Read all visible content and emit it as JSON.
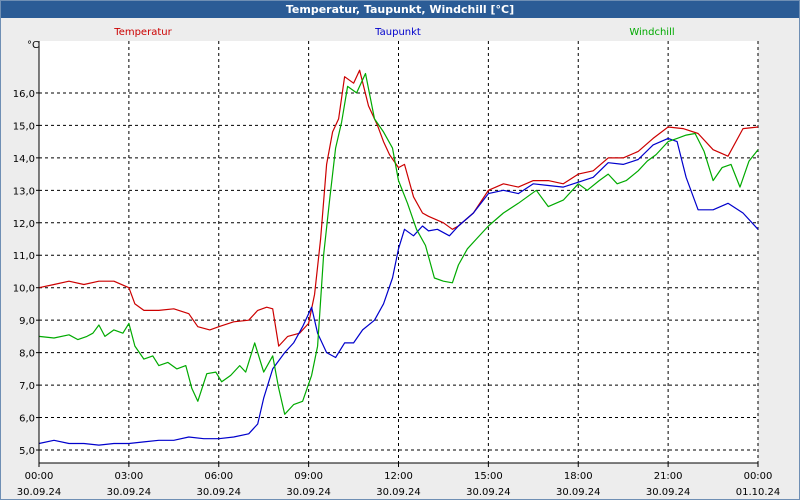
{
  "window": {
    "title": "Temperatur, Taupunkt, Windchill [°C]"
  },
  "chart_data": {
    "type": "line",
    "title": "Temperatur, Taupunkt, Windchill [°C]",
    "ylabel": "°C",
    "xlabel": "",
    "ylim": [
      4.6,
      17.6
    ],
    "xlim": [
      0,
      24
    ],
    "grid": true,
    "legend": "top",
    "y_ticks": [
      5.0,
      6.0,
      7.0,
      8.0,
      9.0,
      10.0,
      11.0,
      12.0,
      13.0,
      14.0,
      15.0,
      16.0
    ],
    "y_tick_labels": [
      "5,0",
      "6,0",
      "7,0",
      "8,0",
      "9,0",
      "10,0",
      "11,0",
      "12,0",
      "13,0",
      "14,0",
      "15,0",
      "16,0"
    ],
    "x_ticks": [
      {
        "t": 0,
        "time": "00:00",
        "date": "30.09.24"
      },
      {
        "t": 3,
        "time": "03:00",
        "date": "30.09.24"
      },
      {
        "t": 6,
        "time": "06:00",
        "date": "30.09.24"
      },
      {
        "t": 9,
        "time": "09:00",
        "date": "30.09.24"
      },
      {
        "t": 12,
        "time": "12:00",
        "date": "30.09.24"
      },
      {
        "t": 15,
        "time": "15:00",
        "date": "30.09.24"
      },
      {
        "t": 18,
        "time": "18:00",
        "date": "30.09.24"
      },
      {
        "t": 21,
        "time": "21:00",
        "date": "30.09.24"
      },
      {
        "t": 24,
        "time": "00:00",
        "date": "01.10.24"
      }
    ],
    "x_unit": "hours since 30.09.24 00:00",
    "series": [
      {
        "name": "Temperatur",
        "color": "#cc0000",
        "points": [
          [
            0,
            10.0
          ],
          [
            0.5,
            10.1
          ],
          [
            1,
            10.2
          ],
          [
            1.5,
            10.1
          ],
          [
            2,
            10.2
          ],
          [
            2.5,
            10.2
          ],
          [
            3,
            10.0
          ],
          [
            3.2,
            9.5
          ],
          [
            3.5,
            9.3
          ],
          [
            4,
            9.3
          ],
          [
            4.5,
            9.35
          ],
          [
            5,
            9.2
          ],
          [
            5.3,
            8.8
          ],
          [
            5.7,
            8.7
          ],
          [
            6,
            8.8
          ],
          [
            6.5,
            8.95
          ],
          [
            7,
            9.0
          ],
          [
            7.3,
            9.3
          ],
          [
            7.6,
            9.4
          ],
          [
            7.8,
            9.35
          ],
          [
            8,
            8.2
          ],
          [
            8.3,
            8.5
          ],
          [
            8.7,
            8.6
          ],
          [
            9,
            8.9
          ],
          [
            9.2,
            9.8
          ],
          [
            9.4,
            11.5
          ],
          [
            9.6,
            13.8
          ],
          [
            9.8,
            14.8
          ],
          [
            10,
            15.2
          ],
          [
            10.2,
            16.5
          ],
          [
            10.5,
            16.3
          ],
          [
            10.7,
            16.7
          ],
          [
            11,
            15.6
          ],
          [
            11.3,
            15.0
          ],
          [
            11.5,
            14.5
          ],
          [
            11.7,
            14.1
          ],
          [
            12,
            13.7
          ],
          [
            12.2,
            13.8
          ],
          [
            12.5,
            12.8
          ],
          [
            12.8,
            12.3
          ],
          [
            13,
            12.2
          ],
          [
            13.5,
            12.0
          ],
          [
            13.8,
            11.8
          ],
          [
            14,
            11.9
          ],
          [
            14.5,
            12.3
          ],
          [
            15,
            13.0
          ],
          [
            15.5,
            13.2
          ],
          [
            16,
            13.1
          ],
          [
            16.5,
            13.3
          ],
          [
            17,
            13.3
          ],
          [
            17.5,
            13.2
          ],
          [
            18,
            13.5
          ],
          [
            18.5,
            13.6
          ],
          [
            19,
            14.0
          ],
          [
            19.5,
            14.0
          ],
          [
            20,
            14.2
          ],
          [
            20.5,
            14.6
          ],
          [
            21,
            14.95
          ],
          [
            21.5,
            14.9
          ],
          [
            22,
            14.75
          ],
          [
            22.5,
            14.25
          ],
          [
            23,
            14.05
          ],
          [
            23.5,
            14.9
          ],
          [
            24,
            14.95
          ]
        ]
      },
      {
        "name": "Taupunkt",
        "color": "#0000cc",
        "points": [
          [
            0,
            5.2
          ],
          [
            0.5,
            5.3
          ],
          [
            1,
            5.2
          ],
          [
            1.5,
            5.2
          ],
          [
            2,
            5.15
          ],
          [
            2.5,
            5.2
          ],
          [
            3,
            5.2
          ],
          [
            3.5,
            5.25
          ],
          [
            4,
            5.3
          ],
          [
            4.5,
            5.3
          ],
          [
            5,
            5.4
          ],
          [
            5.5,
            5.35
          ],
          [
            6,
            5.35
          ],
          [
            6.5,
            5.4
          ],
          [
            7,
            5.5
          ],
          [
            7.3,
            5.8
          ],
          [
            7.5,
            6.6
          ],
          [
            7.8,
            7.5
          ],
          [
            8.2,
            8.0
          ],
          [
            8.5,
            8.3
          ],
          [
            8.8,
            8.8
          ],
          [
            9.1,
            9.4
          ],
          [
            9.3,
            8.6
          ],
          [
            9.6,
            8.0
          ],
          [
            9.9,
            7.85
          ],
          [
            10.2,
            8.3
          ],
          [
            10.5,
            8.3
          ],
          [
            10.8,
            8.7
          ],
          [
            11.2,
            9.0
          ],
          [
            11.5,
            9.5
          ],
          [
            11.8,
            10.3
          ],
          [
            12,
            11.2
          ],
          [
            12.2,
            11.8
          ],
          [
            12.5,
            11.6
          ],
          [
            12.8,
            11.9
          ],
          [
            13,
            11.75
          ],
          [
            13.3,
            11.8
          ],
          [
            13.7,
            11.6
          ],
          [
            14,
            11.9
          ],
          [
            14.5,
            12.3
          ],
          [
            15,
            12.9
          ],
          [
            15.5,
            13.0
          ],
          [
            16,
            12.9
          ],
          [
            16.5,
            13.2
          ],
          [
            17,
            13.15
          ],
          [
            17.5,
            13.1
          ],
          [
            18,
            13.25
          ],
          [
            18.5,
            13.4
          ],
          [
            19,
            13.85
          ],
          [
            19.5,
            13.8
          ],
          [
            20,
            13.95
          ],
          [
            20.5,
            14.4
          ],
          [
            21,
            14.6
          ],
          [
            21.3,
            14.5
          ],
          [
            21.6,
            13.4
          ],
          [
            22,
            12.4
          ],
          [
            22.5,
            12.4
          ],
          [
            23,
            12.6
          ],
          [
            23.5,
            12.3
          ],
          [
            24,
            11.8
          ]
        ]
      },
      {
        "name": "Windchill",
        "color": "#00aa00",
        "points": [
          [
            0,
            8.5
          ],
          [
            0.5,
            8.45
          ],
          [
            1,
            8.55
          ],
          [
            1.3,
            8.4
          ],
          [
            1.6,
            8.5
          ],
          [
            1.8,
            8.6
          ],
          [
            2,
            8.85
          ],
          [
            2.2,
            8.5
          ],
          [
            2.5,
            8.7
          ],
          [
            2.8,
            8.6
          ],
          [
            3,
            8.9
          ],
          [
            3.2,
            8.2
          ],
          [
            3.5,
            7.8
          ],
          [
            3.8,
            7.9
          ],
          [
            4,
            7.6
          ],
          [
            4.3,
            7.7
          ],
          [
            4.6,
            7.5
          ],
          [
            4.9,
            7.6
          ],
          [
            5.1,
            6.9
          ],
          [
            5.3,
            6.5
          ],
          [
            5.6,
            7.35
          ],
          [
            5.9,
            7.4
          ],
          [
            6.1,
            7.1
          ],
          [
            6.4,
            7.3
          ],
          [
            6.7,
            7.6
          ],
          [
            6.9,
            7.4
          ],
          [
            7.2,
            8.3
          ],
          [
            7.5,
            7.4
          ],
          [
            7.8,
            7.9
          ],
          [
            8,
            6.9
          ],
          [
            8.2,
            6.1
          ],
          [
            8.5,
            6.4
          ],
          [
            8.8,
            6.5
          ],
          [
            9.1,
            7.3
          ],
          [
            9.3,
            8.2
          ],
          [
            9.5,
            11.0
          ],
          [
            9.7,
            12.7
          ],
          [
            9.9,
            14.3
          ],
          [
            10.1,
            15.1
          ],
          [
            10.3,
            16.2
          ],
          [
            10.6,
            16.0
          ],
          [
            10.9,
            16.6
          ],
          [
            11.2,
            15.2
          ],
          [
            11.5,
            14.8
          ],
          [
            11.8,
            14.3
          ],
          [
            12,
            13.3
          ],
          [
            12.3,
            12.6
          ],
          [
            12.6,
            11.8
          ],
          [
            12.9,
            11.3
          ],
          [
            13.2,
            10.3
          ],
          [
            13.5,
            10.2
          ],
          [
            13.8,
            10.15
          ],
          [
            14,
            10.7
          ],
          [
            14.3,
            11.2
          ],
          [
            14.6,
            11.5
          ],
          [
            15,
            11.9
          ],
          [
            15.5,
            12.3
          ],
          [
            16,
            12.6
          ],
          [
            16.3,
            12.8
          ],
          [
            16.6,
            13.0
          ],
          [
            17,
            12.5
          ],
          [
            17.5,
            12.7
          ],
          [
            18,
            13.2
          ],
          [
            18.3,
            13.0
          ],
          [
            18.7,
            13.3
          ],
          [
            19,
            13.5
          ],
          [
            19.3,
            13.2
          ],
          [
            19.6,
            13.3
          ],
          [
            20,
            13.6
          ],
          [
            20.3,
            13.9
          ],
          [
            20.6,
            14.1
          ],
          [
            21,
            14.5
          ],
          [
            21.3,
            14.6
          ],
          [
            21.6,
            14.7
          ],
          [
            21.9,
            14.75
          ],
          [
            22.2,
            14.2
          ],
          [
            22.5,
            13.3
          ],
          [
            22.8,
            13.7
          ],
          [
            23.1,
            13.8
          ],
          [
            23.4,
            13.1
          ],
          [
            23.7,
            13.9
          ],
          [
            24,
            14.25
          ]
        ]
      }
    ]
  }
}
